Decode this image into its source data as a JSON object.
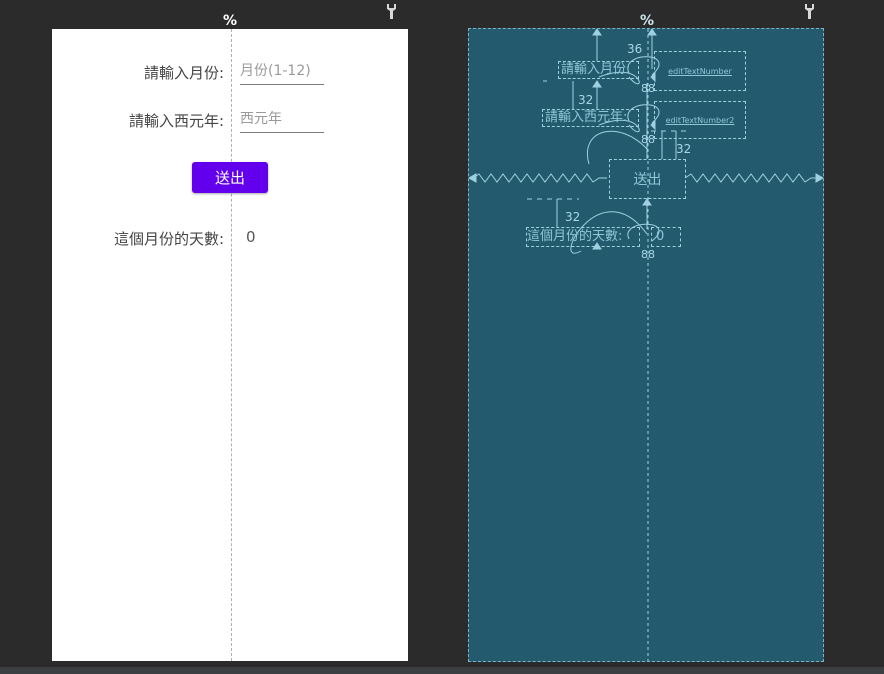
{
  "design": {
    "month_label": "請輸入月份:",
    "month_placeholder": "月份(1-12)",
    "year_label": "請輸入西元年:",
    "year_placeholder": "西元年",
    "submit_label": "送出",
    "days_label": "這個月份的天數:",
    "days_value": "0",
    "guide_marker": "%"
  },
  "blueprint": {
    "month_label": "請輸入月份:",
    "year_label": "請輸入西元年:",
    "submit_label": "送出",
    "days_label": "這個月份的天數:",
    "days_value": "0",
    "edit_month_id": "editTextNumber",
    "edit_year_id": "editTextNumber2",
    "guide_marker": "%",
    "margins": [
      "36",
      "32",
      "32",
      "32"
    ],
    "bias": [
      "88",
      "88",
      "88"
    ]
  },
  "colors": {
    "accent": "#6200ee",
    "canvas": "#2b2b2b",
    "blueprint_bg": "#235a6e",
    "blueprint_line": "#9fd0e0"
  },
  "icons": [
    "percent-guide-icon",
    "pin-icon"
  ]
}
